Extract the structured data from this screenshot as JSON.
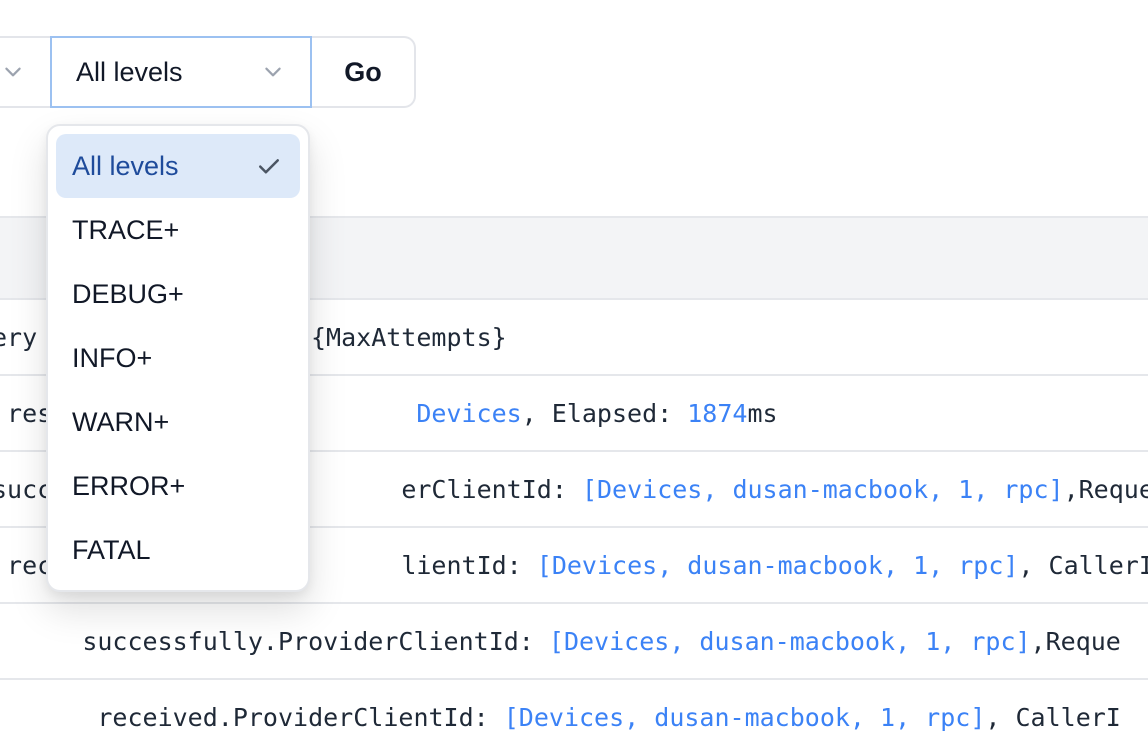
{
  "toolbar": {
    "level_select": {
      "value": "All levels"
    },
    "go_label": "Go"
  },
  "level_dropdown": {
    "options": [
      {
        "label": "All levels",
        "selected": true
      },
      {
        "label": "TRACE+",
        "selected": false
      },
      {
        "label": "DEBUG+",
        "selected": false
      },
      {
        "label": "INFO+",
        "selected": false
      },
      {
        "label": "WARN+",
        "selected": false
      },
      {
        "label": "ERROR+",
        "selected": false
      },
      {
        "label": "FATAL",
        "selected": false
      }
    ]
  },
  "log_rows": [
    [
      {
        "text": "ery"
      },
      {
        "text": "{MaxAttempts}"
      }
    ],
    [
      {
        "text": " res"
      },
      {
        "text": "Devices",
        "accent": true
      },
      {
        "text": ", Elapsed: "
      },
      {
        "text": "1874",
        "accent": true
      },
      {
        "text": "ms"
      }
    ],
    [
      {
        "text": "succ"
      },
      {
        "text": "erClientId: "
      },
      {
        "text": "[Devices, dusan-macbook, 1, rpc]",
        "accent": true
      },
      {
        "text": ",Reque"
      }
    ],
    [
      {
        "text": " rec"
      },
      {
        "text": "lientId: "
      },
      {
        "text": "[Devices, dusan-macbook, 1, rpc]",
        "accent": true
      },
      {
        "text": ", CallerI"
      }
    ],
    [
      {
        "text": "successfully.ProviderClientId: "
      },
      {
        "text": "[Devices, dusan-macbook, 1, rpc]",
        "accent": true
      },
      {
        "text": ",Reque"
      }
    ],
    [
      {
        "text": " received.ProviderClientId: "
      },
      {
        "text": "[Devices, dusan-macbook, 1, rpc]",
        "accent": true
      },
      {
        "text": ", CallerI"
      }
    ]
  ],
  "colors": {
    "accent": "#3b82f6",
    "selected_bg": "#dde9f9",
    "selected_text": "#1e4b9b",
    "focus_border": "#9cc1f1"
  },
  "icons": {
    "select_chevron": "chevron-down-icon",
    "selected_mark": "check-icon"
  }
}
